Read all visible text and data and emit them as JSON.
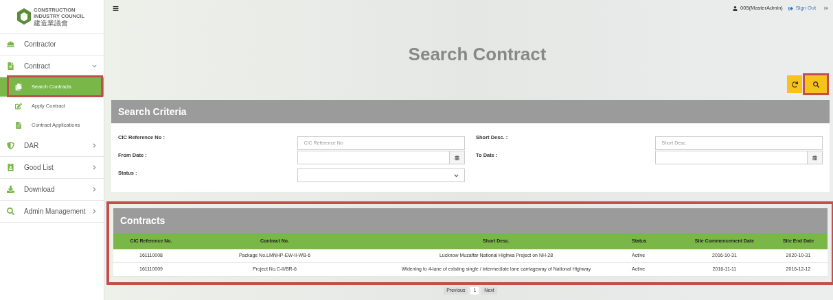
{
  "logo": {
    "lines": [
      "CONSTRUCTION",
      "INDUSTRY COUNCIL",
      "建造業議會"
    ]
  },
  "sidebar": {
    "items": [
      {
        "label": "Contractor",
        "selected": false,
        "has_arrow": false
      },
      {
        "label": "Contract",
        "expanded": true,
        "selected": false,
        "has_arrow": true,
        "children": [
          {
            "label": "Search Contracts",
            "selected": true
          },
          {
            "label": "Apply Contract",
            "selected": false
          },
          {
            "label": "Contract Applications",
            "selected": false
          }
        ]
      },
      {
        "label": "DAR",
        "expanded": false,
        "selected": false,
        "has_arrow": true
      },
      {
        "label": "Good List",
        "expanded": false,
        "selected": false,
        "has_arrow": true
      },
      {
        "label": "Download",
        "expanded": false,
        "selected": false,
        "has_arrow": true
      },
      {
        "label": "Admin Management",
        "expanded": false,
        "selected": false,
        "has_arrow": true
      }
    ]
  },
  "header": {
    "user": "005(MasterAdmin)",
    "sign_out": "Sign Out"
  },
  "page_title": "Search Contract",
  "search_criteria": {
    "title": "Search Criteria",
    "fields": [
      {
        "label": "CIC Reference No :",
        "kind": "text",
        "placeholder": "CIC Reference No"
      },
      {
        "label": "Short Desc. :",
        "kind": "text",
        "placeholder": "Short Desc."
      },
      {
        "label": "From Date :",
        "kind": "date"
      },
      {
        "label": "To Date :",
        "kind": "date"
      },
      {
        "label": "Status :",
        "kind": "select"
      }
    ]
  },
  "contracts": {
    "title": "Contracts",
    "columns": [
      "CIC Reference No.",
      "Contract No.",
      "Short Desc.",
      "Status",
      "Site Commencement Date",
      "Site End Date"
    ],
    "rows": [
      [
        "161110008",
        "Package No.LMNHP-EW-II-WB-6",
        "Lucknow Muzaffar National Highwa Project on NH-28",
        "Active",
        "2016-10-31",
        "2020-10-31"
      ],
      [
        "161110009",
        "Project No.C-II/BR-6",
        "Widening to 4-lane of existing single / intermediate lane carriageway of National Highway",
        "Active",
        "2016-11-11",
        "2016-12-12"
      ]
    ]
  },
  "pagination": {
    "previous": "Previous",
    "pages": [
      {
        "label": "1",
        "selected": true
      }
    ],
    "next": "Next"
  }
}
